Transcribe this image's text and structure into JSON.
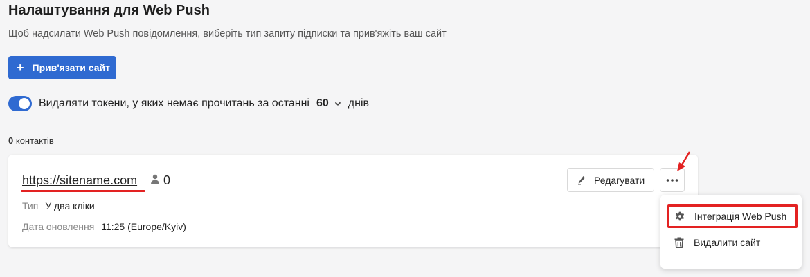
{
  "page": {
    "title": "Налаштування для Web Push",
    "subtitle": "Щоб надсилати Web Push повідомлення, виберіть тип запиту підписки та прив'яжіть ваш сайт"
  },
  "bind_button": {
    "icon": "plus-icon",
    "label": "Прив'язати сайт"
  },
  "token_setting": {
    "enabled": true,
    "label": "Видаляти токени, у яких немає прочитань за останні",
    "days_value": "60",
    "days_suffix": "днів"
  },
  "contacts": {
    "count": "0",
    "label": "контактів"
  },
  "site_card": {
    "url": "https://sitename.com",
    "subscribers_icon": "person-icon",
    "subscribers": "0",
    "type_label": "Тип",
    "type_value": "У два кліки",
    "updated_label": "Дата оновлення",
    "updated_value": "11:25 (Europe/Kyiv)",
    "edit_icon": "pencil-icon",
    "edit_label": "Редагувати",
    "more_icon": "more-dots-icon"
  },
  "dropdown_menu": {
    "items": [
      {
        "icon": "gear-icon",
        "label": "Інтеграція Web Push"
      },
      {
        "icon": "trash-icon",
        "label": "Видалити сайт"
      }
    ]
  },
  "colors": {
    "accent": "#2f6ad1",
    "highlight": "#e32222",
    "background": "#f5f5f6"
  }
}
